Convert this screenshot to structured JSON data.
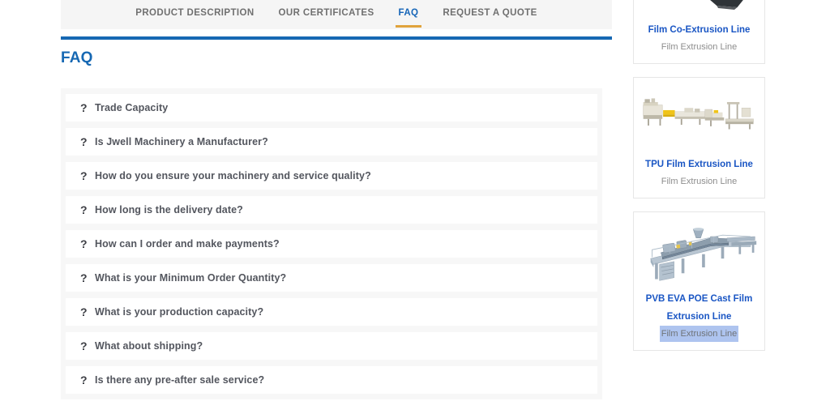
{
  "tabs": [
    {
      "label": "PRODUCT DESCRIPTION",
      "active": false
    },
    {
      "label": "OUR CERTIFICATES",
      "active": false
    },
    {
      "label": "FAQ",
      "active": true
    },
    {
      "label": "REQUEST A QUOTE",
      "active": false
    }
  ],
  "section": {
    "title": "FAQ"
  },
  "faq": {
    "items": [
      {
        "icon": "question-mark-icon",
        "question": "Trade Capacity"
      },
      {
        "icon": "question-mark-icon",
        "question": "Is Jwell Machinery a Manufacturer?"
      },
      {
        "icon": "question-mark-icon",
        "question": "How do you ensure your machinery and service quality?"
      },
      {
        "icon": "question-mark-icon",
        "question": "How long is the delivery date?"
      },
      {
        "icon": "question-mark-icon",
        "question": "How can I order and make payments?"
      },
      {
        "icon": "question-mark-icon",
        "question": "What is your Minimum Order Quantity?"
      },
      {
        "icon": "question-mark-icon",
        "question": "What is your production capacity?"
      },
      {
        "icon": "question-mark-icon",
        "question": "What about shipping?"
      },
      {
        "icon": "question-mark-icon",
        "question": "Is there any pre-after sale service?"
      }
    ]
  },
  "sidebar": {
    "cards": [
      {
        "title": "Film Co-Extrusion Line",
        "subtitle": "Film Extrusion Line",
        "image": "extrusion-line-photo",
        "clipped": true,
        "selected": false
      },
      {
        "title": "TPU Film Extrusion Line",
        "subtitle": "Film Extrusion Line",
        "image": "extrusion-line-photo",
        "clipped": false,
        "selected": false
      },
      {
        "title": "PVB EVA POE Cast Film Extrusion Line",
        "subtitle": "Film Extrusion Line",
        "image": "cast-film-line-photo",
        "clipped": false,
        "selected": true
      }
    ]
  },
  "colors": {
    "accent_blue": "#1668b3",
    "link_blue": "#1a56c4",
    "tab_active_blue": "#1565b8",
    "tab_underline_gold": "#e0a33c",
    "selection_highlight": "#aec4ef"
  }
}
